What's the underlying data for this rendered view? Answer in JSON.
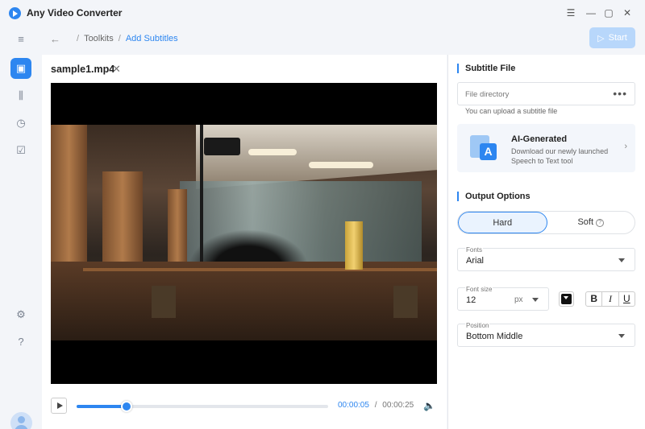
{
  "app": {
    "title": "Any Video Converter"
  },
  "window": {
    "menu_icon": "☰",
    "minimize_icon": "—",
    "maximize_icon": "▢",
    "close_icon": "✕"
  },
  "breadcrumb": {
    "items": [
      "Toolkits",
      "Add Subtitles"
    ],
    "separator": "/"
  },
  "toolbar": {
    "start_label": "Start"
  },
  "player": {
    "file_name": "sample1.mp4",
    "current_time": "00:00:05",
    "time_separator": "/",
    "total_time": "00:00:25",
    "progress": 0.2
  },
  "subtitle_file": {
    "section_title": "Subtitle File",
    "placeholder": "File directory",
    "more_label": "•••",
    "hint": "You can upload a subtitle file",
    "ai_card": {
      "title": "AI-Generated",
      "description": "Download our newly launched Speech to Text tool"
    }
  },
  "output_options": {
    "section_title": "Output Options",
    "mode_hard": "Hard",
    "mode_soft": "Soft",
    "selected_mode": "Hard",
    "fonts_label": "Fonts",
    "font_value": "Arial",
    "font_size_label": "Font size",
    "font_size_value": "12",
    "font_size_unit": "px",
    "text_color": "#111111",
    "bold_label": "B",
    "italic_label": "I",
    "underline_label": "U",
    "position_label": "Position",
    "position_value": "Bottom Middle"
  },
  "colors": {
    "accent": "#2d86f0",
    "start_disabled": "#b8d7fb"
  }
}
